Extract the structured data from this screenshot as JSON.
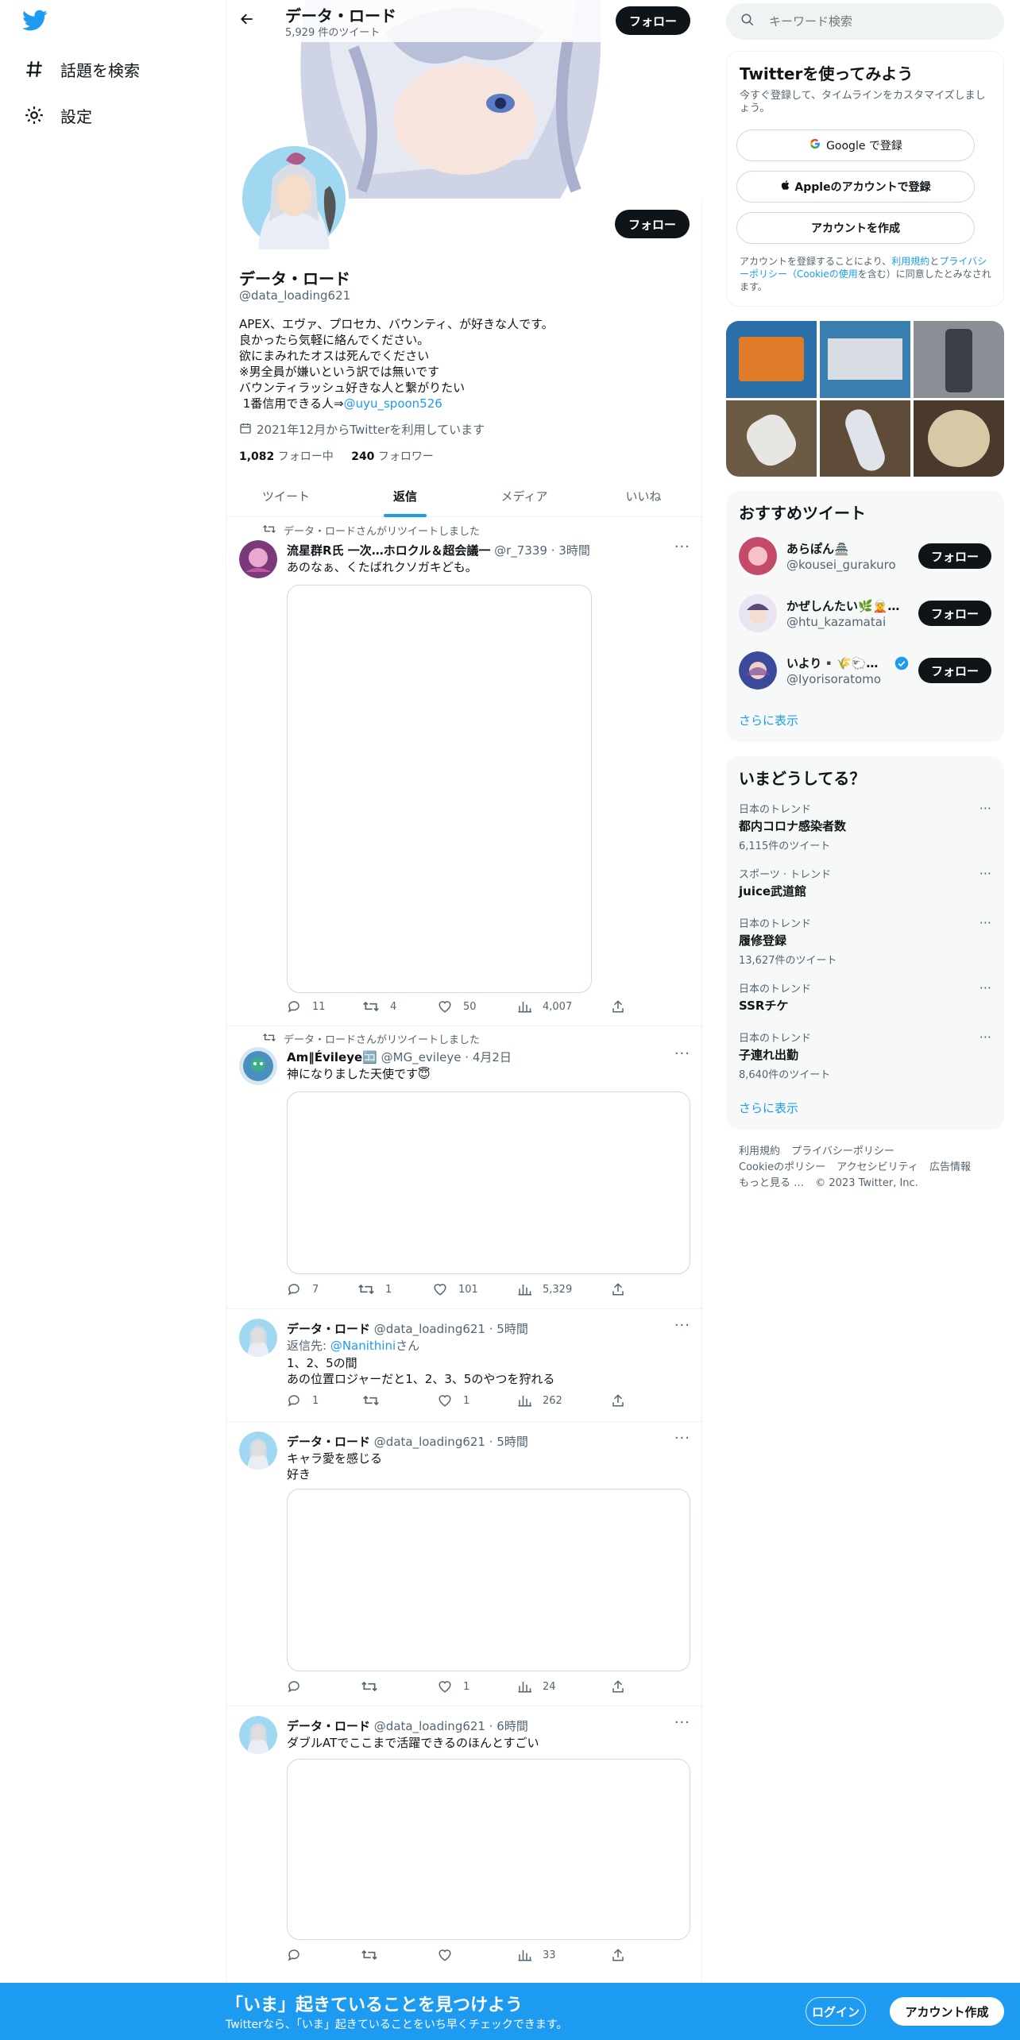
{
  "nav": {
    "items": [
      {
        "label": "話題を検索",
        "icon": "hashtag-icon"
      },
      {
        "label": "設定",
        "icon": "gear-icon"
      }
    ]
  },
  "header": {
    "name": "データ・ロード",
    "tweet_count": "5,929 件のツイート",
    "follow": "フォロー"
  },
  "profile": {
    "follow": "フォロー",
    "name": "データ・ロード",
    "handle": "@data_loading621",
    "bio_lines": [
      "APEX、エヴァ、プロセカ、バウンティ、が好きな人です。",
      "良かったら気軽に絡んでください。",
      "欲にまみれたオスは死んでください",
      "※男全員が嫌いという訳では無いです",
      "バウンティラッシュ好きな人と繋がりたい",
      " 1番信用できる人⇒"
    ],
    "bio_link": "@uyu_spoon526",
    "joined": "2021年12月からTwitterを利用しています",
    "following_count": "1,082",
    "following_label": "フォロー中",
    "followers_count": "240",
    "followers_label": "フォロワー"
  },
  "tabs": [
    {
      "label": "ツイート",
      "active": false
    },
    {
      "label": "返信",
      "active": true
    },
    {
      "label": "メディア",
      "active": false
    },
    {
      "label": "いいね",
      "active": false
    }
  ],
  "tweets": [
    {
      "retweeted_by": "データ・ロードさんがリツイートしました",
      "name": "流星群R氏 一次…ホロクル＆超会議一",
      "handle": "@r_7339",
      "time": "3時間",
      "text_lines": [
        "あのなぁ、くたばれクソガキども。"
      ],
      "replies": "11",
      "retweets": "4",
      "likes": "50",
      "views": "4,007"
    },
    {
      "retweeted_by": "データ・ロードさんがリツイートしました",
      "name": "Am‖Évileye🈁",
      "handle": "@MG_evileye",
      "time": "4月2日",
      "text_lines": [
        "神になりました天使です😇"
      ],
      "replies": "7",
      "retweets": "1",
      "likes": "101",
      "views": "5,329"
    },
    {
      "name": "データ・ロード",
      "handle": "@data_loading621",
      "time": "5時間",
      "reply_to_prefix": "返信先: ",
      "reply_to": "@Nanithini",
      "reply_to_suffix": "さん",
      "text_lines": [
        "1、2、5の間",
        "あの位置ロジャーだと1、2、3、5のやつを狩れる"
      ],
      "replies": "1",
      "retweets": "",
      "likes": "1",
      "views": "262"
    },
    {
      "name": "データ・ロード",
      "handle": "@data_loading621",
      "time": "5時間",
      "text_lines": [
        "キャラ愛を感じる",
        "好き"
      ],
      "replies": "",
      "retweets": "",
      "likes": "1",
      "views": "24"
    },
    {
      "name": "データ・ロード",
      "handle": "@data_loading621",
      "time": "6時間",
      "text_lines": [
        "ダブルATでここまで活躍できるのほんとすごい"
      ],
      "replies": "",
      "retweets": "",
      "likes": "",
      "views": "33"
    }
  ],
  "search": {
    "placeholder": "キーワード検索"
  },
  "signup": {
    "title": "Twitterを使ってみよう",
    "subtitle": "今すぐ登録して、タイムラインをカスタマイズしましょう。",
    "google": "Google で登録",
    "apple": "Appleのアカウントで登録",
    "create": "アカウントを作成",
    "terms_prefix": "アカウントを登録することにより、",
    "terms_link": "利用規約",
    "terms_and": "と",
    "privacy_link": "プライバシーポリシー",
    "cookie_link": "（Cookieの使用",
    "terms_suffix": "を含む）に同意したとみなされます。"
  },
  "recommended": {
    "title": "おすすめツイート",
    "users": [
      {
        "name": "あらぽん🏯",
        "handle": "@kousei_gurakuro",
        "follow": "フォロー"
      },
      {
        "name": "かぜしんたい🌿🧝…",
        "handle": "@htu_kazamatai",
        "follow": "フォロー"
      },
      {
        "name": "いより▪️🌾🐑…",
        "handle": "@Iyorisoratomo",
        "follow": "フォロー",
        "verified": true
      }
    ],
    "more": "さらに表示"
  },
  "trends": {
    "title": "いまどうしてる？",
    "items": [
      {
        "meta": "日本のトレンド",
        "name": "都内コロナ感染者数",
        "count": "6,115件のツイート"
      },
      {
        "meta": "スポーツ · トレンド",
        "name": "juice武道館",
        "count": ""
      },
      {
        "meta": "日本のトレンド",
        "name": "履修登録",
        "count": "13,627件のツイート"
      },
      {
        "meta": "日本のトレンド",
        "name": "SSRチケ",
        "count": ""
      },
      {
        "meta": "日本のトレンド",
        "name": "子連れ出勤",
        "count": "8,640件のツイート"
      }
    ],
    "more": "さらに表示"
  },
  "footer": {
    "links1": [
      "利用規約",
      "プライバシーポリシー"
    ],
    "links2": [
      "Cookieのポリシー",
      "アクセシビリティ",
      "広告情報"
    ],
    "more": "もっと見る …",
    "copyright": "© 2023 Twitter, Inc."
  },
  "bottom": {
    "headline": "「いま」起きていることを見つけよう",
    "sub": "Twitterなら、「いま」起きていることをいち早くチェックできます。",
    "login": "ログイン",
    "signup": "アカウント作成"
  },
  "colors": {
    "accent": "#1d9bf0",
    "text": "#0f1419",
    "muted": "#536471"
  }
}
